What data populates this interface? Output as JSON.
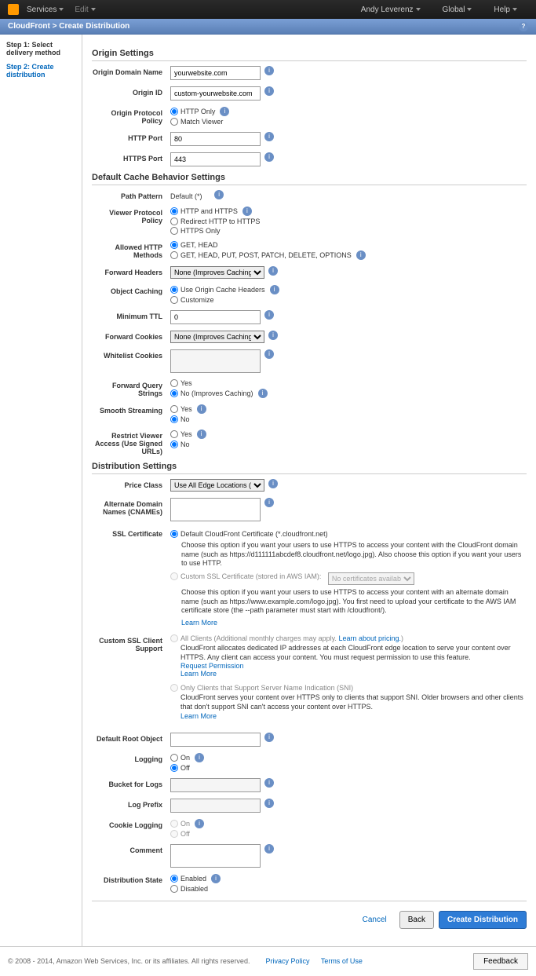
{
  "topbar": {
    "services": "Services",
    "edit": "Edit",
    "user": "Andy Leverenz",
    "global": "Global",
    "help": "Help"
  },
  "breadcrumb": {
    "service": "CloudFront",
    "page": "Create Distribution"
  },
  "sidebar": {
    "step1": "Step 1: Select delivery method",
    "step2": "Step 2: Create distribution"
  },
  "sections": {
    "origin": "Origin Settings",
    "cache": "Default Cache Behavior Settings",
    "dist": "Distribution Settings"
  },
  "labels": {
    "originDomain": "Origin Domain Name",
    "originId": "Origin ID",
    "originProtocol": "Origin Protocol Policy",
    "httpPort": "HTTP Port",
    "httpsPort": "HTTPS Port",
    "pathPattern": "Path Pattern",
    "viewerProtocol": "Viewer Protocol Policy",
    "allowedMethods": "Allowed HTTP Methods",
    "forwardHeaders": "Forward Headers",
    "objectCaching": "Object Caching",
    "minTtl": "Minimum TTL",
    "forwardCookies": "Forward Cookies",
    "whitelistCookies": "Whitelist Cookies",
    "forwardQuery": "Forward Query Strings",
    "smoothStreaming": "Smooth Streaming",
    "restrictAccess": "Restrict Viewer Access (Use Signed URLs)",
    "priceClass": "Price Class",
    "altDomain": "Alternate Domain Names (CNAMEs)",
    "sslCert": "SSL Certificate",
    "sslClient": "Custom SSL Client Support",
    "defaultRoot": "Default Root Object",
    "logging": "Logging",
    "bucketLogs": "Bucket for Logs",
    "logPrefix": "Log Prefix",
    "cookieLogging": "Cookie Logging",
    "comment": "Comment",
    "distState": "Distribution State"
  },
  "values": {
    "originDomain": "yourwebsite.com",
    "originId": "custom-yourwebsite.com",
    "httpPort": "80",
    "httpsPort": "443",
    "pathPattern": "Default (*)",
    "minTtl": "0"
  },
  "radios": {
    "httpOnly": "HTTP Only",
    "matchViewer": "Match Viewer",
    "httpAndHttps": "HTTP and HTTPS",
    "redirectHttps": "Redirect HTTP to HTTPS",
    "httpsOnly": "HTTPS Only",
    "getHead": "GET, HEAD",
    "getHeadAll": "GET, HEAD, PUT, POST, PATCH, DELETE, OPTIONS",
    "useOrigin": "Use Origin Cache Headers",
    "customize": "Customize",
    "yes": "Yes",
    "no": "No",
    "noImproves": "No (Improves Caching)",
    "on": "On",
    "off": "Off",
    "enabled": "Enabled",
    "disabled": "Disabled"
  },
  "selects": {
    "noneImproves": "None (Improves Caching)",
    "allEdge": "Use All Edge Locations (Best Perform",
    "noCerts": "No certificates available"
  },
  "ssl": {
    "default": "Default CloudFront Certificate (*.cloudfront.net)",
    "defaultDesc": "Choose this option if you want your users to use HTTPS to access your content with the CloudFront domain name (such as https://d111111abcdef8.cloudfront.net/logo.jpg). Also choose this option if you want your users to use HTTP.",
    "custom": "Custom SSL Certificate (stored in AWS IAM):",
    "customDesc": "Choose this option if you want your users to use HTTPS to access your content with an alternate domain name (such as https://www.example.com/logo.jpg). You first need to upload your certificate to the AWS IAM certificate store (the --path parameter must start with /cloudfront/).",
    "learnMore": "Learn More"
  },
  "sslClient": {
    "allClients": "All Clients (Additional monthly charges may apply.",
    "learnPricing": "Learn about pricing.",
    "allDesc": "CloudFront allocates dedicated IP addresses at each CloudFront edge location to serve your content over HTTPS. Any client can access your content. You must request permission to use this feature.",
    "reqPerm": "Request Permission",
    "sniOnly": "Only Clients that Support Server Name Indication (SNI)",
    "sniDesc": "CloudFront serves your content over HTTPS only to clients that support SNI. Older browsers and other clients that don't support SNI can't access your content over HTTPS."
  },
  "buttons": {
    "cancel": "Cancel",
    "back": "Back",
    "create": "Create Distribution"
  },
  "footer": {
    "copyright": "© 2008 - 2014, Amazon Web Services, Inc. or its affiliates. All rights reserved.",
    "privacy": "Privacy Policy",
    "terms": "Terms of Use",
    "feedback": "Feedback"
  }
}
